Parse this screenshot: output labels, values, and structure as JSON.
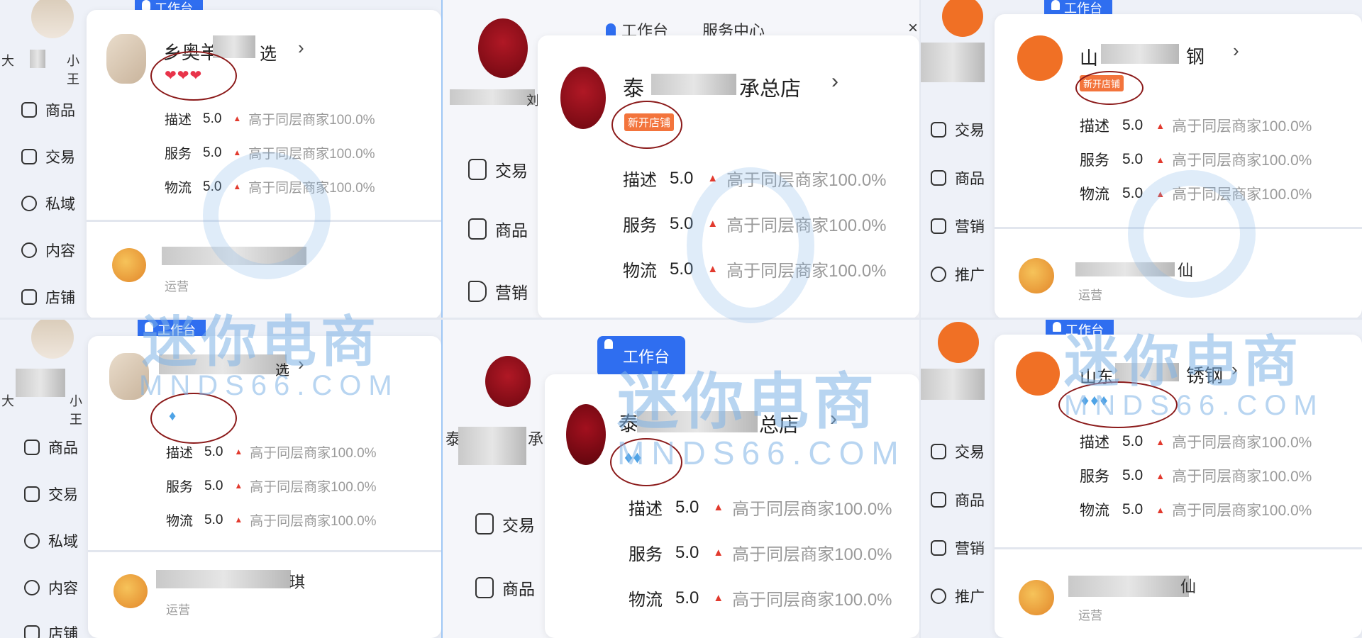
{
  "nav": {
    "goods": "商品",
    "trade": "交易",
    "private": "私域",
    "content": "内容",
    "store": "店铺",
    "marketing": "营销",
    "promote": "推广"
  },
  "top": {
    "workbench": "工作台",
    "service_center": "服务中心",
    "close": "×"
  },
  "panels": {
    "p1": {
      "store": "乡奥羊",
      "store_tail": "选",
      "level_icons": "❤❤❤",
      "sub_suffix": "",
      "role": "运营",
      "left_name": "大",
      "left_name_tail": "小王"
    },
    "p2": {
      "store": "泰",
      "store_tail": "承总店",
      "badge": "新开店铺",
      "left_name_tail": "刘"
    },
    "p3": {
      "store": "山",
      "store_tail": "钢",
      "badge": "新开店铺",
      "sub_suffix": "仙",
      "role": "运营"
    },
    "p4": {
      "store_tail": "选",
      "level_icons": "♦",
      "sub_suffix": "琪",
      "role": "运营",
      "left_name": "大",
      "left_name_tail": "小王"
    },
    "p5": {
      "store": "泰",
      "store_tail": "总店",
      "level_icons": "♦♦",
      "left_name": "泰",
      "left_name_tail": "承"
    },
    "p6": {
      "store": "山东",
      "store_tail": "锈钢",
      "level_icons": "♦♦♦",
      "sub_suffix": "仙",
      "role": "运营"
    }
  },
  "ratings": {
    "describe": "描述",
    "service": "服务",
    "logistics": "物流",
    "score": "5.0",
    "arrow": "▲",
    "compare": "高于同层商家100.0%"
  },
  "watermark": {
    "cn": "迷你电商",
    "en": "MNDS66.COM"
  },
  "colors": {
    "accent_blue": "#2f6ef0",
    "badge_orange": "#f3743c",
    "circle_red": "#8b1a1a",
    "up_red": "#e23a2e"
  }
}
